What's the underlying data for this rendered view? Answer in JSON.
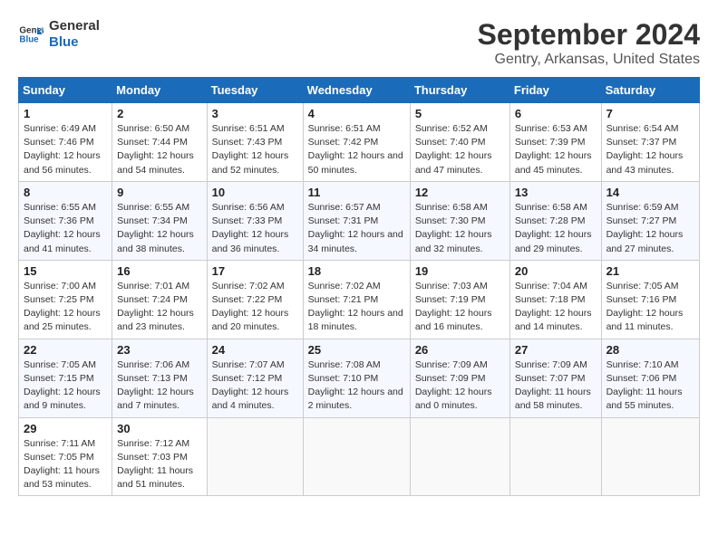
{
  "logo": {
    "line1": "General",
    "line2": "Blue"
  },
  "title": "September 2024",
  "subtitle": "Gentry, Arkansas, United States",
  "days_of_week": [
    "Sunday",
    "Monday",
    "Tuesday",
    "Wednesday",
    "Thursday",
    "Friday",
    "Saturday"
  ],
  "weeks": [
    [
      {
        "day": "1",
        "sunrise": "6:49 AM",
        "sunset": "7:46 PM",
        "daylight": "12 hours and 56 minutes."
      },
      {
        "day": "2",
        "sunrise": "6:50 AM",
        "sunset": "7:44 PM",
        "daylight": "12 hours and 54 minutes."
      },
      {
        "day": "3",
        "sunrise": "6:51 AM",
        "sunset": "7:43 PM",
        "daylight": "12 hours and 52 minutes."
      },
      {
        "day": "4",
        "sunrise": "6:51 AM",
        "sunset": "7:42 PM",
        "daylight": "12 hours and 50 minutes."
      },
      {
        "day": "5",
        "sunrise": "6:52 AM",
        "sunset": "7:40 PM",
        "daylight": "12 hours and 47 minutes."
      },
      {
        "day": "6",
        "sunrise": "6:53 AM",
        "sunset": "7:39 PM",
        "daylight": "12 hours and 45 minutes."
      },
      {
        "day": "7",
        "sunrise": "6:54 AM",
        "sunset": "7:37 PM",
        "daylight": "12 hours and 43 minutes."
      }
    ],
    [
      {
        "day": "8",
        "sunrise": "6:55 AM",
        "sunset": "7:36 PM",
        "daylight": "12 hours and 41 minutes."
      },
      {
        "day": "9",
        "sunrise": "6:55 AM",
        "sunset": "7:34 PM",
        "daylight": "12 hours and 38 minutes."
      },
      {
        "day": "10",
        "sunrise": "6:56 AM",
        "sunset": "7:33 PM",
        "daylight": "12 hours and 36 minutes."
      },
      {
        "day": "11",
        "sunrise": "6:57 AM",
        "sunset": "7:31 PM",
        "daylight": "12 hours and 34 minutes."
      },
      {
        "day": "12",
        "sunrise": "6:58 AM",
        "sunset": "7:30 PM",
        "daylight": "12 hours and 32 minutes."
      },
      {
        "day": "13",
        "sunrise": "6:58 AM",
        "sunset": "7:28 PM",
        "daylight": "12 hours and 29 minutes."
      },
      {
        "day": "14",
        "sunrise": "6:59 AM",
        "sunset": "7:27 PM",
        "daylight": "12 hours and 27 minutes."
      }
    ],
    [
      {
        "day": "15",
        "sunrise": "7:00 AM",
        "sunset": "7:25 PM",
        "daylight": "12 hours and 25 minutes."
      },
      {
        "day": "16",
        "sunrise": "7:01 AM",
        "sunset": "7:24 PM",
        "daylight": "12 hours and 23 minutes."
      },
      {
        "day": "17",
        "sunrise": "7:02 AM",
        "sunset": "7:22 PM",
        "daylight": "12 hours and 20 minutes."
      },
      {
        "day": "18",
        "sunrise": "7:02 AM",
        "sunset": "7:21 PM",
        "daylight": "12 hours and 18 minutes."
      },
      {
        "day": "19",
        "sunrise": "7:03 AM",
        "sunset": "7:19 PM",
        "daylight": "12 hours and 16 minutes."
      },
      {
        "day": "20",
        "sunrise": "7:04 AM",
        "sunset": "7:18 PM",
        "daylight": "12 hours and 14 minutes."
      },
      {
        "day": "21",
        "sunrise": "7:05 AM",
        "sunset": "7:16 PM",
        "daylight": "12 hours and 11 minutes."
      }
    ],
    [
      {
        "day": "22",
        "sunrise": "7:05 AM",
        "sunset": "7:15 PM",
        "daylight": "12 hours and 9 minutes."
      },
      {
        "day": "23",
        "sunrise": "7:06 AM",
        "sunset": "7:13 PM",
        "daylight": "12 hours and 7 minutes."
      },
      {
        "day": "24",
        "sunrise": "7:07 AM",
        "sunset": "7:12 PM",
        "daylight": "12 hours and 4 minutes."
      },
      {
        "day": "25",
        "sunrise": "7:08 AM",
        "sunset": "7:10 PM",
        "daylight": "12 hours and 2 minutes."
      },
      {
        "day": "26",
        "sunrise": "7:09 AM",
        "sunset": "7:09 PM",
        "daylight": "12 hours and 0 minutes."
      },
      {
        "day": "27",
        "sunrise": "7:09 AM",
        "sunset": "7:07 PM",
        "daylight": "11 hours and 58 minutes."
      },
      {
        "day": "28",
        "sunrise": "7:10 AM",
        "sunset": "7:06 PM",
        "daylight": "11 hours and 55 minutes."
      }
    ],
    [
      {
        "day": "29",
        "sunrise": "7:11 AM",
        "sunset": "7:05 PM",
        "daylight": "11 hours and 53 minutes."
      },
      {
        "day": "30",
        "sunrise": "7:12 AM",
        "sunset": "7:03 PM",
        "daylight": "11 hours and 51 minutes."
      },
      null,
      null,
      null,
      null,
      null
    ]
  ],
  "labels": {
    "sunrise": "Sunrise:",
    "sunset": "Sunset:",
    "daylight": "Daylight:"
  }
}
